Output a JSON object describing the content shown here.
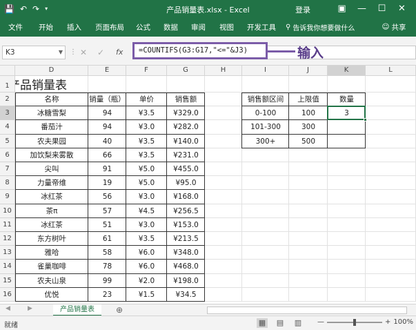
{
  "titlebar": {
    "doc_title": "产品销量表.xlsx - Excel",
    "login": "登录",
    "save_icon": "save-icon",
    "undo_icon": "undo-icon",
    "redo_icon": "redo-icon"
  },
  "ribbon": {
    "tabs": [
      "文件",
      "开始",
      "插入",
      "页面布局",
      "公式",
      "数据",
      "审阅",
      "视图",
      "开发工具"
    ],
    "tell_me": "告诉我你想要做什么",
    "share": "共享"
  },
  "formula_bar": {
    "name_box": "K3",
    "formula": "=COUNTIFS(G3:G17,\"<=\"&J3)",
    "annotation": "输入"
  },
  "columns": [
    "D",
    "E",
    "F",
    "G",
    "H",
    "I",
    "J",
    "K",
    "L"
  ],
  "rows": [
    "1",
    "2",
    "3",
    "4",
    "5",
    "6",
    "7",
    "8",
    "9",
    "10",
    "11",
    "12",
    "13",
    "14",
    "15",
    "16"
  ],
  "sheet": {
    "title": "产品销量表",
    "headers": [
      "名称",
      "销量（瓶）",
      "单价",
      "销售额"
    ],
    "data": [
      [
        "冰糖雪梨",
        "94",
        "¥3.5",
        "¥329.0"
      ],
      [
        "番茄汁",
        "94",
        "¥3.0",
        "¥282.0"
      ],
      [
        "农夫果园",
        "40",
        "¥3.5",
        "¥140.0"
      ],
      [
        "加饮梨来雾散",
        "66",
        "¥3.5",
        "¥231.0"
      ],
      [
        "尖叫",
        "91",
        "¥5.0",
        "¥455.0"
      ],
      [
        "力量帝维",
        "19",
        "¥5.0",
        "¥95.0"
      ],
      [
        "冰红茶",
        "56",
        "¥3.0",
        "¥168.0"
      ],
      [
        "茶π",
        "57",
        "¥4.5",
        "¥256.5"
      ],
      [
        "冰红茶",
        "51",
        "¥3.0",
        "¥153.0"
      ],
      [
        "东方树叶",
        "61",
        "¥3.5",
        "¥213.5"
      ],
      [
        "雅哈",
        "58",
        "¥6.0",
        "¥348.0"
      ],
      [
        "雀巢咖啡",
        "78",
        "¥6.0",
        "¥468.0"
      ],
      [
        "农夫山泉",
        "99",
        "¥2.0",
        "¥198.0"
      ],
      [
        "优悦",
        "23",
        "¥1.5",
        "¥34.5"
      ]
    ],
    "side_headers": [
      "销售额区间",
      "上限值",
      "数量"
    ],
    "side_data": [
      [
        "0-100",
        "100",
        "3"
      ],
      [
        "101-300",
        "300",
        ""
      ],
      [
        "300+",
        "500",
        ""
      ]
    ]
  },
  "sheet_tab": "产品销量表",
  "status": {
    "ready": "就绪",
    "zoom": "100%"
  }
}
